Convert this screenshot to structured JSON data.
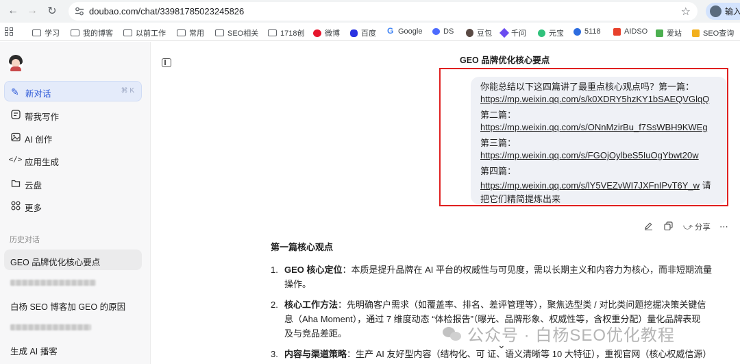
{
  "browser": {
    "url": "doubao.com/chat/33981785023245826",
    "profile_label": "输入"
  },
  "bookmarks": [
    {
      "label": "学习",
      "icon": "folder-icon"
    },
    {
      "label": "我的博客",
      "icon": "folder-icon"
    },
    {
      "label": "以前工作",
      "icon": "folder-icon"
    },
    {
      "label": "常用",
      "icon": "folder-icon"
    },
    {
      "label": "SEO相关",
      "icon": "folder-icon"
    },
    {
      "label": "1718创",
      "icon": "folder-icon"
    },
    {
      "label": "微博",
      "icon": "weibo-icon"
    },
    {
      "label": "百度",
      "icon": "baidu-icon"
    },
    {
      "label": "Google",
      "icon": "google-icon"
    },
    {
      "label": "DS",
      "icon": "deepseek-icon"
    },
    {
      "label": "豆包",
      "icon": "doubao-icon"
    },
    {
      "label": "千问",
      "icon": "qianwen-icon"
    },
    {
      "label": "元宝",
      "icon": "yuanbao-icon"
    },
    {
      "label": "5118",
      "icon": "5118-icon"
    },
    {
      "label": "AIDSO",
      "icon": "aidso-icon"
    },
    {
      "label": "爱站",
      "icon": "aizhan-icon"
    },
    {
      "label": "SEO查询",
      "icon": "seo-query-icon"
    }
  ],
  "sidebar": {
    "new_chat": {
      "label": "新对话",
      "shortcut": "⌘ K"
    },
    "items": [
      {
        "label": "帮我写作",
        "icon": "write-icon"
      },
      {
        "label": "AI 创作",
        "icon": "image-icon"
      },
      {
        "label": "应用生成",
        "icon": "code-icon"
      },
      {
        "label": "云盘",
        "icon": "cloud-drive-icon"
      },
      {
        "label": "更多",
        "icon": "apps-icon"
      }
    ],
    "history_title": "历史对话",
    "history": [
      {
        "label": "GEO 品牌优化核心要点",
        "active": true
      },
      {
        "label": "",
        "blurred": true
      },
      {
        "label": "白杨 SEO 博客加 GEO 的原因"
      },
      {
        "label": "",
        "blurred": true
      },
      {
        "label": "生成 AI 播客"
      }
    ]
  },
  "chat": {
    "title": "GEO 品牌优化核心要点",
    "user_message": {
      "line1": "你能总结以下这四篇讲了最重点核心观点吗？第一篇：",
      "link1": "https://mp.weixin.qq.com/s/k0XDRY5hzKY1bSAEQVGlqQ",
      "label2": "第二篇：",
      "link2": "https://mp.weixin.qq.com/s/ONnMzirBu_f7SsWBH9KWEg",
      "label3": "第三篇：",
      "link3": "https://mp.weixin.qq.com/s/FGOjOylbeS5IuOgYbwt20w",
      "label4": "第四篇：",
      "link4": "https://mp.weixin.qq.com/s/lY5VEZvWI7JXFnIPvT6Y_w",
      "tail1": " 请",
      "tail2": "把它们精简提炼出来"
    },
    "actions": {
      "share_label": "分享"
    },
    "answer": {
      "heading": "第一篇核心观点",
      "points": [
        {
          "num": "1.",
          "title": "GEO 核心定位",
          "line1": "：本质是提升品牌在 AI 平台的权威性与可见度，需以长期主义和内容力为核心，而非短期流量",
          "line2": "操作。"
        },
        {
          "num": "2.",
          "title": "核心工作方法",
          "line1": "：先明确客户需求（如覆盖率、排名、差评管理等），聚焦选型类 / 对比类问题挖掘决策关键信",
          "line2": "息（Aha Moment），通过 7 维度动态 “体检报告”（曝光、品牌形象、权威性等，含权重分配）量化品牌表现",
          "line3": "及与竞品差距。"
        },
        {
          "num": "3.",
          "title": "内容与渠道策略",
          "line1": "：生产 AI 友好型内容（结构化、可      证、语义清晰等 10 大特征），重视官网（核心权威信源）"
        }
      ]
    }
  },
  "watermark": "公众号 · 白杨SEO优化教程"
}
